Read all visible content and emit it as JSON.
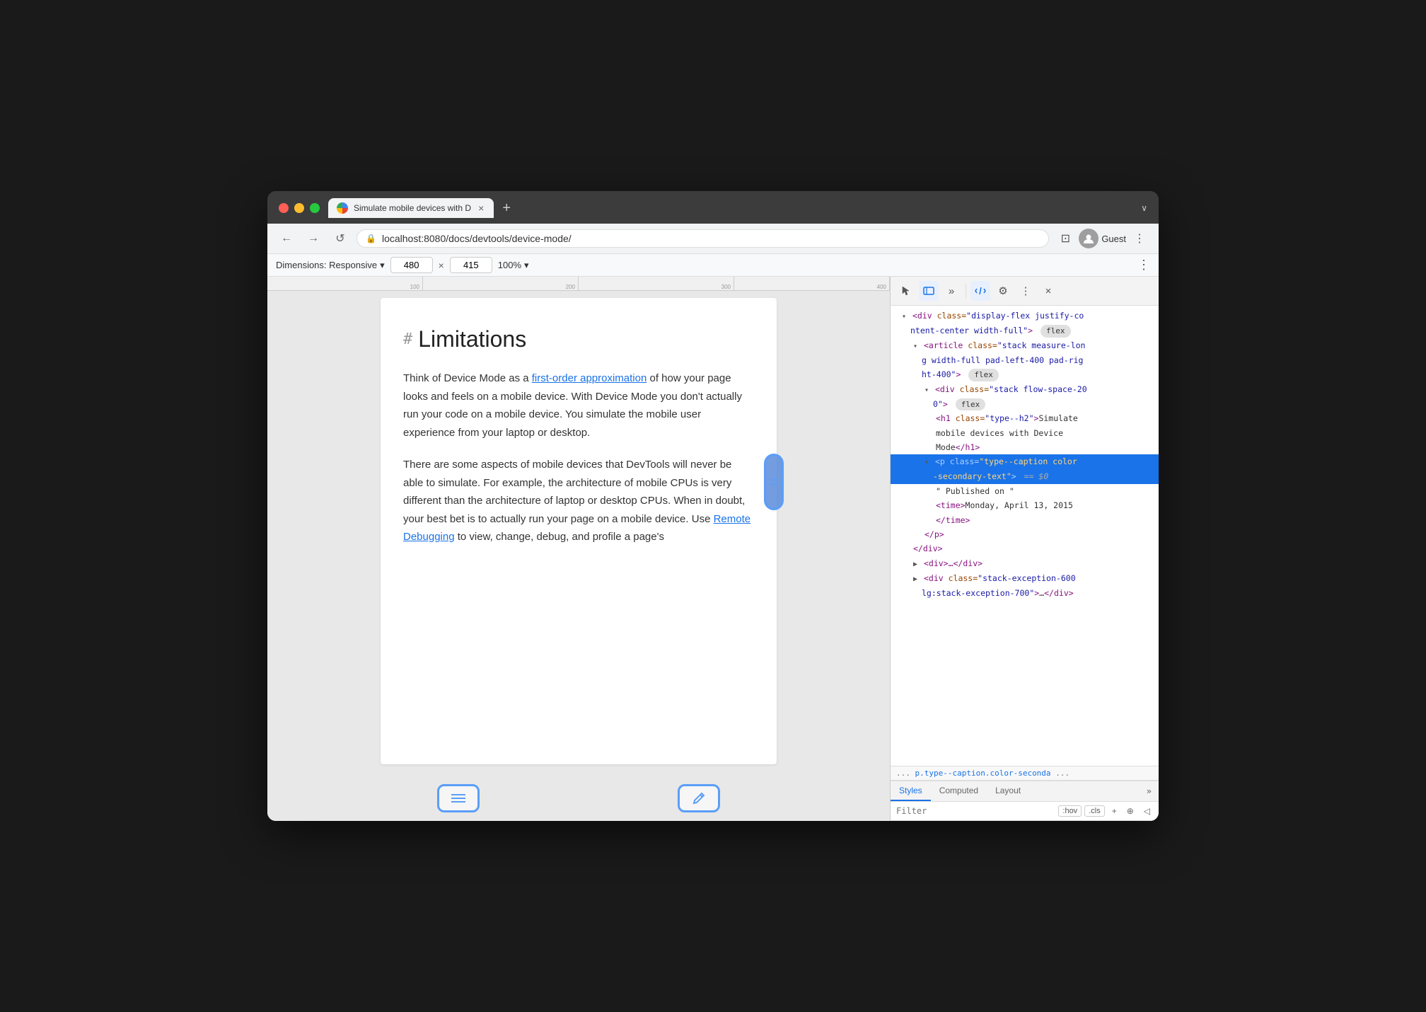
{
  "browser": {
    "tab": {
      "favicon_alt": "Chrome icon",
      "title": "Simulate mobile devices with D",
      "close_label": "×"
    },
    "new_tab_label": "+",
    "tab_menu_label": "∨",
    "nav": {
      "back_label": "←",
      "forward_label": "→",
      "reload_label": "↺",
      "address": "localhost:8080/docs/devtools/device-mode/",
      "desktop_icon": "⊡",
      "user_label": "Guest",
      "menu_label": "⋮"
    }
  },
  "device_toolbar": {
    "dimensions_label": "Dimensions: Responsive",
    "width_value": "480",
    "height_value": "415",
    "zoom_label": "100%",
    "more_label": "⋮"
  },
  "article": {
    "heading_hash": "#",
    "heading": "Limitations",
    "para1": "Think of Device Mode as a",
    "para1_link": "first-order approximation",
    "para1_rest": "of how your page looks and feels on a mobile device. With Device Mode you don't actually run your code on a mobile device. You simulate the mobile user experience from your laptop or desktop.",
    "para2": "There are some aspects of mobile devices that DevTools will never be able to simulate. For example, the architecture of mobile CPUs is very different than the architecture of laptop or desktop CPUs. When in doubt, your best bet is to actually run your page on a mobile device. Use",
    "para2_link": "Remote Debugging",
    "para2_rest": "to view, change, debug, and profile a page's"
  },
  "devtools": {
    "toolbar": {
      "pointer_icon": "↖",
      "device_icon": "▭",
      "more_panels_label": "»",
      "elements_icon": "< >",
      "settings_icon": "⚙",
      "more_label": "⋮",
      "close_label": "×"
    },
    "html": [
      {
        "indent": 0,
        "content": "<div class=\"display-flex justify-co",
        "suffix": "ntent-center width-full\">",
        "badge": "flex",
        "has_triangle": true,
        "open": true
      },
      {
        "indent": 1,
        "content": "<article class=\"stack measure-lon",
        "suffix": "g width-full pad-left-400 pad-rig",
        "suffix2": "ht-400\">",
        "badge": "flex",
        "has_triangle": true,
        "open": true
      },
      {
        "indent": 2,
        "content": "<div class=\"stack flow-space-20",
        "suffix": "0\">",
        "badge": "flex",
        "has_triangle": true,
        "open": true
      },
      {
        "indent": 3,
        "content": "<h1 class=\"type--h2\">Simulate mobile devices with Device Mode</h1>",
        "has_triangle": false
      },
      {
        "indent": 3,
        "content": "<p class=\"type--caption color",
        "suffix": "-secondary-text\">",
        "extra": "== $0",
        "has_triangle": true,
        "open": true,
        "selected": true
      },
      {
        "indent": 4,
        "content": "\" Published on \"",
        "has_triangle": false
      },
      {
        "indent": 4,
        "content": "<time>Monday, April 13, 2015",
        "has_triangle": false
      },
      {
        "indent": 4,
        "content": "</time>",
        "has_triangle": false
      },
      {
        "indent": 3,
        "content": "</p>",
        "has_triangle": false
      },
      {
        "indent": 2,
        "content": "</div>",
        "has_triangle": false
      },
      {
        "indent": 2,
        "content": "<div>…</div>",
        "has_triangle": true,
        "open": false
      },
      {
        "indent": 2,
        "content": "<div class=\"stack-exception-600",
        "suffix": "lg:stack-exception-700\">…</div>",
        "has_triangle": true,
        "open": false
      }
    ],
    "breadcrumb": "p.type--caption.color-seconda",
    "breadcrumb_more": "...",
    "styles_tabs": [
      "Styles",
      "Computed",
      "Layout"
    ],
    "styles_tab_more": "»",
    "filter_placeholder": "Filter",
    "filter_hov": ":hov",
    "filter_cls": ".cls",
    "filter_plus": "+",
    "filter_icon1": "⊕",
    "filter_icon2": "◁"
  }
}
